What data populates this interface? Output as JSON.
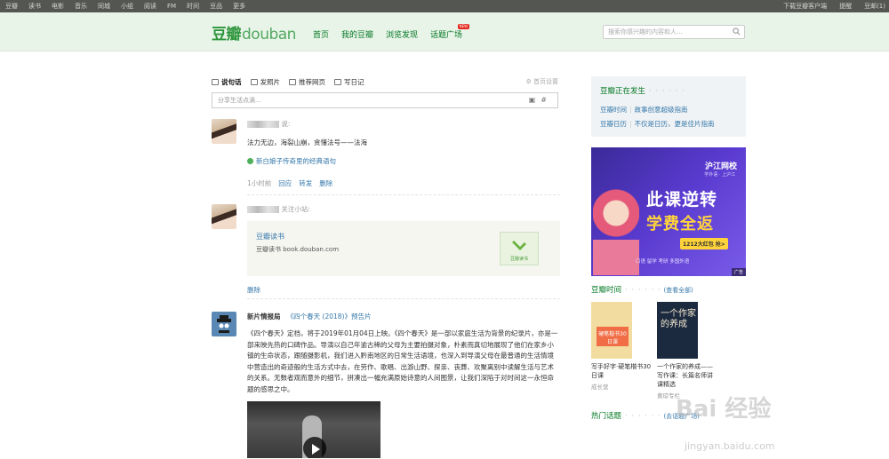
{
  "topnav": {
    "items": [
      "豆瓣",
      "读书",
      "电影",
      "音乐",
      "同城",
      "小组",
      "阅读",
      "FM",
      "时间",
      "豆品",
      "更多"
    ],
    "right": [
      "下载豆瓣客户端",
      "提醒",
      "豆邮(1)"
    ]
  },
  "header": {
    "logo_cn": "豆瓣",
    "logo_en": "douban",
    "nav": [
      "首页",
      "我的豆瓣",
      "浏览发现",
      "话题广场"
    ],
    "new_badge": "NEW",
    "search_placeholder": "搜索你感兴趣的内容和人..."
  },
  "actions": {
    "items": [
      "说句话",
      "发照片",
      "推荐网页",
      "写日记"
    ],
    "home_settings": "首页设置",
    "input_placeholder": "分享生活点滴..."
  },
  "feed": {
    "post1": {
      "suffix": "说:",
      "text": "法力无边，海裂山崩，贪懂法号——法海",
      "link": "新白娘子传奇里的经典语句",
      "time": "1小时前",
      "ops": [
        "回应",
        "转发",
        "删除"
      ]
    },
    "post2": {
      "suffix": "关注小站:",
      "card_title": "豆瓣读书",
      "card_desc": "豆瓣读书 book.douban.com",
      "card_logo": "豆瓣读书",
      "op": "删除"
    },
    "post3": {
      "author": "新片情报局",
      "movie": "《四个春天 (2018)》预告片",
      "para": "《四个春天》定档，将于2019年01月04日上映。《四个春天》是一部以家庭生活为背景的纪录片，亦是一部来映先热的口碑作品。导演以自己年逾古稀的父母为主要拍摄对象，朴素而真切地展现了他们在家乡小镇的生命状态，跟随摄影机，我们进入黔南地区的日常生活语境，也深入到导演父母在最普通的生活情境中营造出的奇迹般的生活方式中去，在劳作、歌唱、出游山野、探亲、丧葬、欢聚离别中读解生活与艺术的关系。无数者观而意外的细节，拼凑出一幅充满原始诗意的人间图景，让我们深陷于对时间这一永恒命题的感思之中。"
    }
  },
  "side": {
    "happening_title": "豆瓣正在发生",
    "links_row1": [
      "豆瓣时间",
      "故事创意超级指南"
    ],
    "links_row2": [
      "豆瓣日历",
      "不仅是日历，更是佳片指南"
    ],
    "ad": {
      "brand": "沪江网校",
      "brand_sub": "学外语 · 上沪江",
      "headline1": "此课逆转",
      "headline2": "学费全返",
      "pill": "1212大红包 抢>",
      "tags": "口语 留学 考研 多国外语",
      "adtag": "广告"
    },
    "time_title": "豆瓣时间",
    "time_viewall": "(查看全部)",
    "books": [
      {
        "cover": "硬笔楷书30日课",
        "title": "写手好字·硬笔楷书30日课",
        "author": "成长营"
      },
      {
        "cover": "一个作家的养成",
        "title": "一个作家的养成——写作课：长篇名师讲课精选",
        "author": "黄琼专栏"
      }
    ],
    "hot_title": "热门话题",
    "hot_viewall": "(去话题广场)"
  },
  "watermark": {
    "main": "Bai 经验",
    "sub": "jingyan.baidu.com"
  }
}
